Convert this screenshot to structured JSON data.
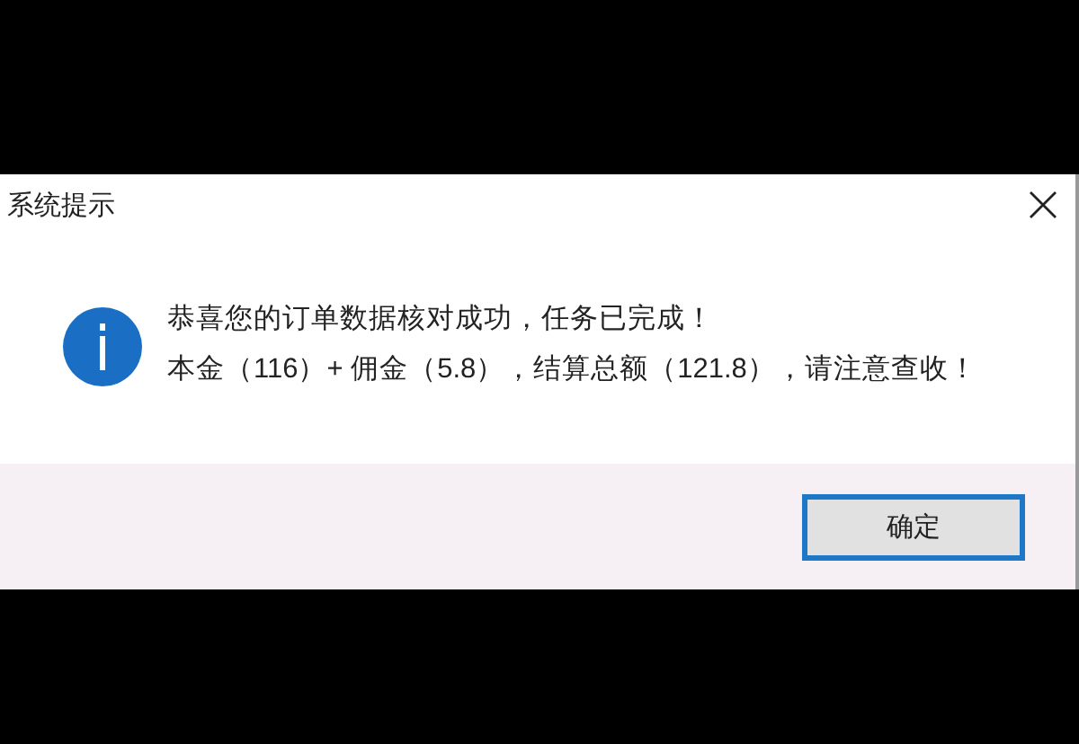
{
  "window": {
    "title": "系统提示"
  },
  "message": {
    "lines": [
      "恭喜您的订单数据核对成功，任务已完成！",
      "本金（116）+ 佣金（5.8），结算总额（121.8），请注意查收！"
    ]
  },
  "buttons": [
    {
      "label": "确定",
      "selected": true
    }
  ]
}
